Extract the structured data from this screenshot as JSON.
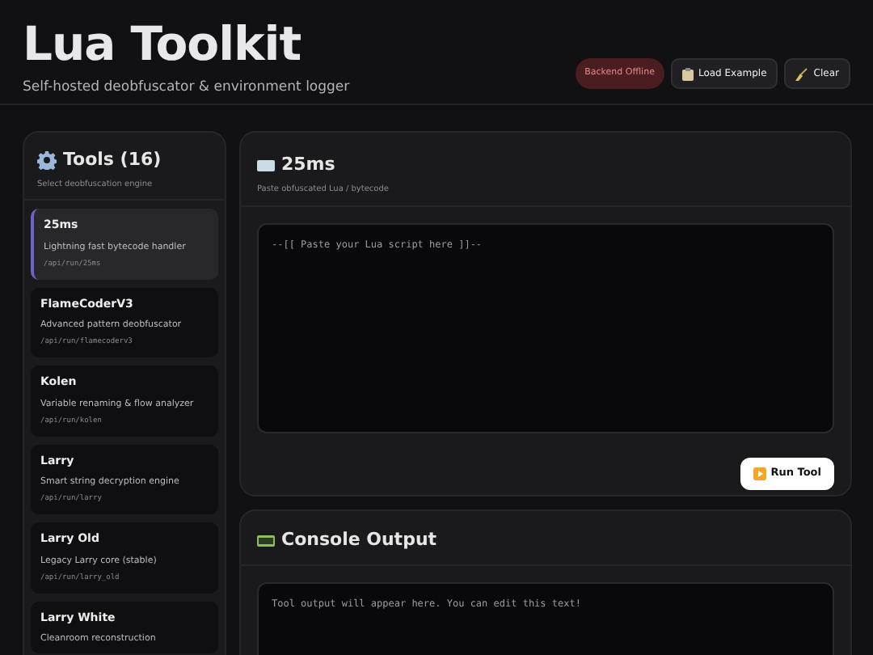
{
  "header": {
    "title": "Lua Toolkit",
    "subtitle": "Self-hosted deobfuscator & environment logger",
    "status": {
      "label": "Backend Offline",
      "online": false
    },
    "buttons": [
      {
        "label": "Load Example",
        "kind": "clipboard"
      },
      {
        "label": "Clear",
        "kind": "broom"
      }
    ]
  },
  "sidebar": {
    "title": "Tools (16)",
    "subtitle": "Select deobfuscation engine",
    "tools": [
      {
        "name": "25ms",
        "description": "Lightning fast bytecode handler",
        "path": "/api/run/25ms",
        "selected": true
      },
      {
        "name": "FlameCoderV3",
        "description": "Advanced pattern deobfuscator",
        "path": "/api/run/flamecoderv3",
        "selected": false
      },
      {
        "name": "Kolen",
        "description": "Variable renaming & flow analyzer",
        "path": "/api/run/kolen",
        "selected": false
      },
      {
        "name": "Larry",
        "description": "Smart string decryption engine",
        "path": "/api/run/larry",
        "selected": false
      },
      {
        "name": "Larry Old",
        "description": "Legacy Larry core (stable)",
        "path": "/api/run/larry_old",
        "selected": false
      },
      {
        "name": "Larry White",
        "description": "Cleanroom reconstruction",
        "selected": false
      }
    ]
  },
  "editor": {
    "title": "25ms",
    "subtitle": "Paste obfuscated Lua / bytecode",
    "placeholder": "--[[ Paste your Lua script here ]]--",
    "run_button": "Run Tool"
  },
  "console": {
    "title": "Console Output",
    "placeholder": "Tool output will appear here. You can edit this text!"
  }
}
